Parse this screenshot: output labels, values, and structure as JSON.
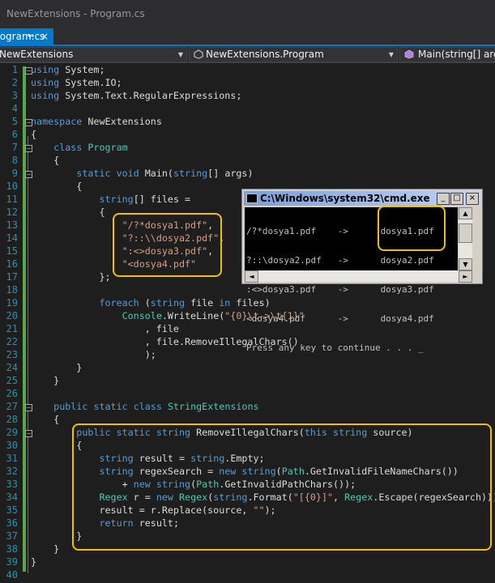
{
  "window": {
    "title": "NewExtensions - Program.cs"
  },
  "tab": {
    "label": "Program.cs",
    "pin": "⇔",
    "close": "×"
  },
  "navbar": {
    "project": "NewExtensions",
    "class": "NewExtensions.Program",
    "member": "Main(string[] args)"
  },
  "colors": {
    "keyword": "#569cd6",
    "type": "#4ec9b0",
    "string": "#d69d85",
    "line_number": "#2b91af",
    "change_bar": "#57a64a",
    "highlight": "#f0c000",
    "accent": "#007acc"
  },
  "editor": {
    "lines": [
      [
        [
          "kw",
          "using"
        ],
        [
          "t",
          " System;"
        ]
      ],
      [
        [
          "kw",
          "using"
        ],
        [
          "t",
          " System.IO;"
        ]
      ],
      [
        [
          "kw",
          "using"
        ],
        [
          "t",
          " System.Text.RegularExpressions;"
        ]
      ],
      [],
      [
        [
          "kw",
          "namespace"
        ],
        [
          "t",
          " NewExtensions"
        ]
      ],
      [
        [
          "t",
          "{"
        ]
      ],
      [
        [
          "t",
          "    "
        ],
        [
          "kw",
          "class"
        ],
        [
          "t",
          " "
        ],
        [
          "ty",
          "Program"
        ]
      ],
      [
        [
          "t",
          "    {"
        ]
      ],
      [
        [
          "t",
          "        "
        ],
        [
          "kw",
          "static"
        ],
        [
          "t",
          " "
        ],
        [
          "kw",
          "void"
        ],
        [
          "t",
          " Main("
        ],
        [
          "kw",
          "string"
        ],
        [
          "t",
          "[] args)"
        ]
      ],
      [
        [
          "t",
          "        {"
        ]
      ],
      [
        [
          "t",
          "            "
        ],
        [
          "kw",
          "string"
        ],
        [
          "t",
          "[] files ="
        ]
      ],
      [
        [
          "t",
          "            {"
        ]
      ],
      [
        [
          "t",
          "                "
        ],
        [
          "st",
          "\"/?*dosya1.pdf\""
        ],
        [
          "t",
          ","
        ]
      ],
      [
        [
          "t",
          "                "
        ],
        [
          "st",
          "\"?::\\\\dosya2.pdf\""
        ],
        [
          "t",
          ","
        ]
      ],
      [
        [
          "t",
          "                "
        ],
        [
          "st",
          "\":<>dosya3.pdf\""
        ],
        [
          "t",
          ","
        ]
      ],
      [
        [
          "t",
          "                "
        ],
        [
          "st",
          "\"<dosya4.pdf\""
        ]
      ],
      [
        [
          "t",
          "            };"
        ]
      ],
      [],
      [
        [
          "t",
          "            "
        ],
        [
          "kw",
          "foreach"
        ],
        [
          "t",
          " ("
        ],
        [
          "kw",
          "string"
        ],
        [
          "t",
          " file "
        ],
        [
          "kw",
          "in"
        ],
        [
          "t",
          " files)"
        ]
      ],
      [
        [
          "t",
          "                "
        ],
        [
          "ty",
          "Console"
        ],
        [
          "t",
          ".WriteLine("
        ],
        [
          "st",
          "\"{0}\\t->\\t{1}\""
        ]
      ],
      [
        [
          "t",
          "                    , file"
        ]
      ],
      [
        [
          "t",
          "                    , file.RemoveIllegalChars()"
        ]
      ],
      [
        [
          "t",
          "                    );"
        ]
      ],
      [
        [
          "t",
          "        }"
        ]
      ],
      [
        [
          "t",
          "    }"
        ]
      ],
      [],
      [
        [
          "t",
          "    "
        ],
        [
          "kw",
          "public"
        ],
        [
          "t",
          " "
        ],
        [
          "kw",
          "static"
        ],
        [
          "t",
          " "
        ],
        [
          "kw",
          "class"
        ],
        [
          "t",
          " "
        ],
        [
          "ty",
          "StringExtensions"
        ]
      ],
      [
        [
          "t",
          "    {"
        ]
      ],
      [
        [
          "t",
          "        "
        ],
        [
          "kw",
          "public"
        ],
        [
          "t",
          " "
        ],
        [
          "kw",
          "static"
        ],
        [
          "t",
          " "
        ],
        [
          "kw",
          "string"
        ],
        [
          "t",
          " RemoveIllegalChars("
        ],
        [
          "kw",
          "this"
        ],
        [
          "t",
          " "
        ],
        [
          "kw",
          "string"
        ],
        [
          "t",
          " source)"
        ]
      ],
      [
        [
          "t",
          "        {"
        ]
      ],
      [
        [
          "t",
          "            "
        ],
        [
          "kw",
          "string"
        ],
        [
          "t",
          " result = "
        ],
        [
          "kw",
          "string"
        ],
        [
          "t",
          ".Empty;"
        ]
      ],
      [
        [
          "t",
          "            "
        ],
        [
          "kw",
          "string"
        ],
        [
          "t",
          " regexSearch = "
        ],
        [
          "kw",
          "new"
        ],
        [
          "t",
          " "
        ],
        [
          "kw",
          "string"
        ],
        [
          "t",
          "("
        ],
        [
          "ty",
          "Path"
        ],
        [
          "t",
          ".GetInvalidFileNameChars())"
        ]
      ],
      [
        [
          "t",
          "                + "
        ],
        [
          "kw",
          "new"
        ],
        [
          "t",
          " "
        ],
        [
          "kw",
          "string"
        ],
        [
          "t",
          "("
        ],
        [
          "ty",
          "Path"
        ],
        [
          "t",
          ".GetInvalidPathChars());"
        ]
      ],
      [
        [
          "t",
          "            "
        ],
        [
          "ty",
          "Regex"
        ],
        [
          "t",
          " r = "
        ],
        [
          "kw",
          "new"
        ],
        [
          "t",
          " "
        ],
        [
          "ty",
          "Regex"
        ],
        [
          "t",
          "("
        ],
        [
          "kw",
          "string"
        ],
        [
          "t",
          ".Format("
        ],
        [
          "st",
          "\"[{0}]\""
        ],
        [
          "t",
          ", "
        ],
        [
          "ty",
          "Regex"
        ],
        [
          "t",
          ".Escape(regexSearch)));"
        ]
      ],
      [
        [
          "t",
          "            result = r.Replace(source, "
        ],
        [
          "st",
          "\"\""
        ],
        [
          "t",
          ");"
        ]
      ],
      [
        [
          "t",
          "            "
        ],
        [
          "kw",
          "return"
        ],
        [
          "t",
          " result;"
        ]
      ],
      [
        [
          "t",
          "        }"
        ]
      ],
      [
        [
          "t",
          "    }"
        ]
      ],
      [
        [
          "t",
          "}"
        ]
      ],
      []
    ]
  },
  "console": {
    "title": "C:\\Windows\\system32\\cmd.exe",
    "minimize": "_",
    "maximize": "□",
    "close": "×",
    "output": [
      "/?*dosya1.pdf    ->      dosya1.pdf",
      "?::\\dosya2.pdf   ->      dosya2.pdf",
      ":<>dosya3.pdf    ->      dosya3.pdf",
      "<dosya4.pdf      ->      dosya4.pdf",
      "Press any key to continue . . . _"
    ],
    "scroll_up": "▲",
    "scroll_down": "▼",
    "scroll_left": "◄",
    "scroll_right": "►"
  }
}
